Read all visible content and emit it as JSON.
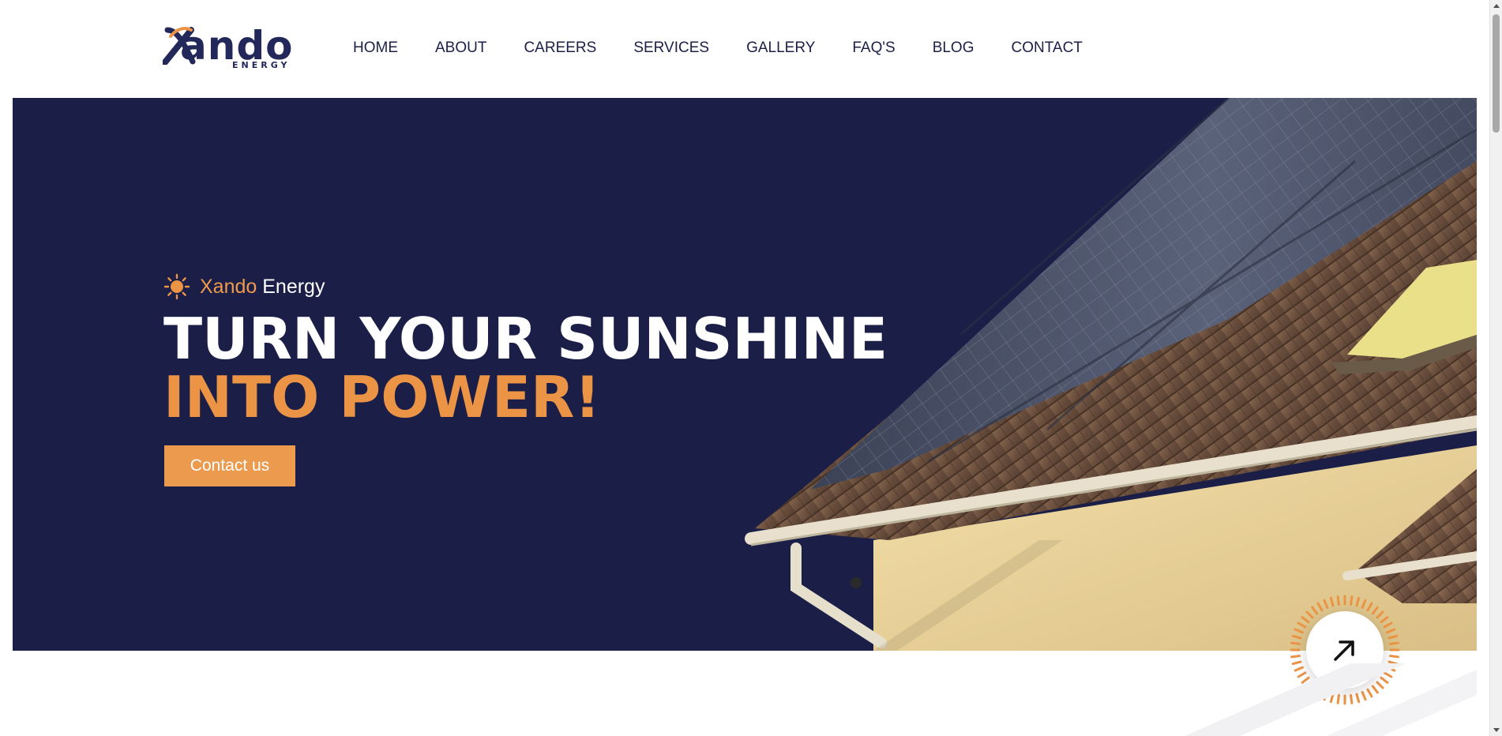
{
  "brand": {
    "logo_word": "ando",
    "logo_sub": "ENERGY",
    "logo_alt": "Xando Energy",
    "colors": {
      "navy": "#1b1f48",
      "orange": "#ec9446",
      "white": "#ffffff"
    }
  },
  "nav": {
    "items": [
      {
        "label": "HOME"
      },
      {
        "label": "ABOUT"
      },
      {
        "label": "CAREERS"
      },
      {
        "label": "SERVICES"
      },
      {
        "label": "GALLERY"
      },
      {
        "label": "FAQ'S"
      },
      {
        "label": "BLOG"
      },
      {
        "label": "CONTACT"
      }
    ]
  },
  "hero": {
    "eyebrow_accent": "Xando",
    "eyebrow_rest": "Energy",
    "eyebrow_icon": "sun-icon",
    "headline_line1": "TURN YOUR SUNSHINE",
    "headline_line2": "INTO POWER!",
    "cta_label": "Contact us",
    "image": "solar-panels-on-roof"
  },
  "scroll_top": {
    "icon": "arrow-up-right-icon"
  }
}
